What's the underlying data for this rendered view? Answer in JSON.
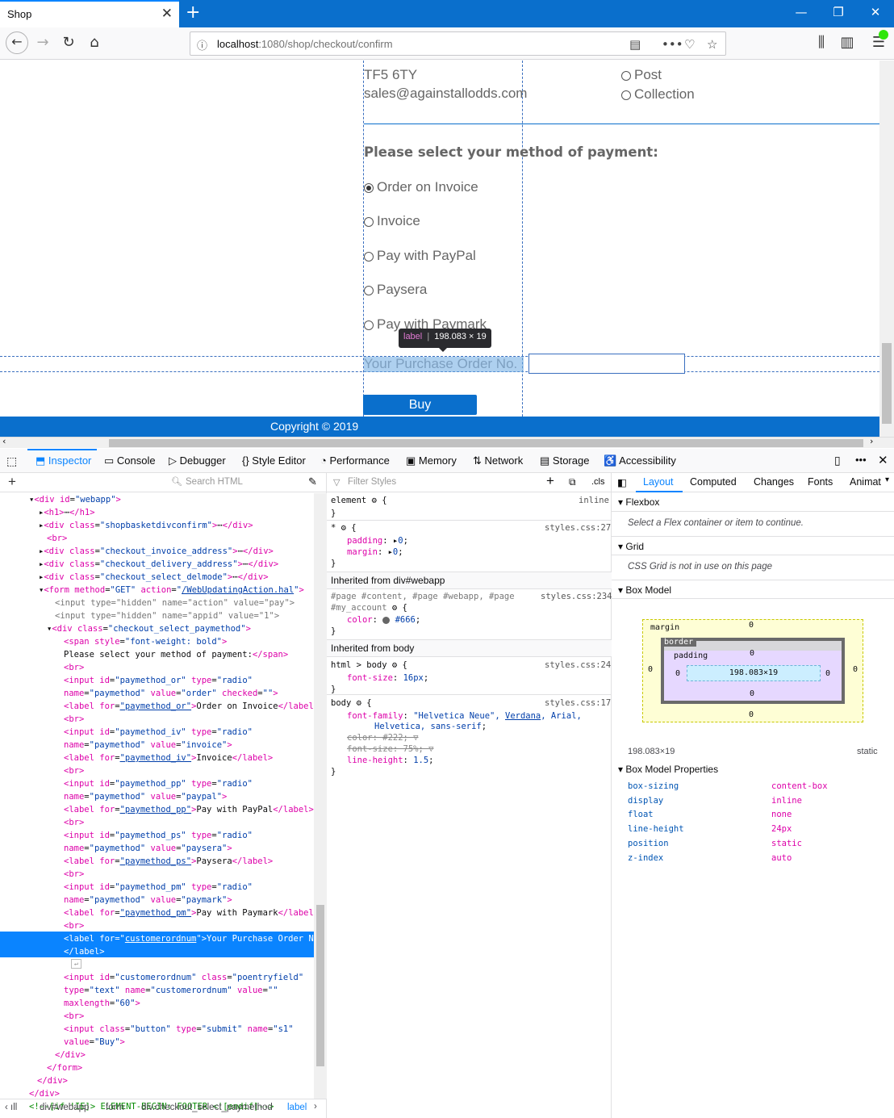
{
  "browser": {
    "tab_title": "Shop",
    "url_host": "localhost",
    "url_port_path": ":1080/shop/checkout/confirm"
  },
  "page": {
    "address_lines": [
      "TF5 6TY",
      "sales@againstallodds.com"
    ],
    "delivery_options": [
      "Post",
      "Collection"
    ],
    "payment_heading": "Please select your method of payment:",
    "payment_options": [
      "Order on Invoice",
      "Invoice",
      "Pay with PayPal",
      "Paysera",
      "Pay with Paymark"
    ],
    "selected_payment": "Order on Invoice",
    "po_label": "Your Purchase Order No.",
    "po_value": "",
    "buy_label": "Buy",
    "copyright": "Copyright © 2019",
    "tooltip_tag": "label",
    "tooltip_size": "198.083 × 19"
  },
  "devtools": {
    "tabs": [
      "Inspector",
      "Console",
      "Debugger",
      "Style Editor",
      "Performance",
      "Memory",
      "Network",
      "Storage",
      "Accessibility"
    ],
    "search_html_placeholder": "Search HTML",
    "filter_styles_placeholder": "Filter Styles",
    "cls_label": ".cls",
    "sidebar_tabs": [
      "Layout",
      "Computed",
      "Changes",
      "Fonts",
      "Animat"
    ],
    "flexbox_title": "Flexbox",
    "flexbox_msg": "Select a Flex container or item to continue.",
    "grid_title": "Grid",
    "grid_msg": "CSS Grid is not in use on this page",
    "boxmodel_title": "Box Model",
    "bm_margin": "margin",
    "bm_border": "border",
    "bm_padding": "padding",
    "bm_content": "198.083×19",
    "bm_zero": "0",
    "bm_size": "198.083×19",
    "bm_position": "static",
    "bm_props_title": "Box Model Properties",
    "bm_props": [
      {
        "k": "box-sizing",
        "v": "content-box"
      },
      {
        "k": "display",
        "v": "inline"
      },
      {
        "k": "float",
        "v": "none"
      },
      {
        "k": "line-height",
        "v": "24px"
      },
      {
        "k": "position",
        "v": "static"
      },
      {
        "k": "z-index",
        "v": "auto"
      }
    ],
    "breadcrumbs": [
      "div#webapp",
      "form",
      "div.checkout_select_paymethod",
      "label"
    ],
    "rules": {
      "element": "element",
      "inline": "inline",
      "star_src": "styles.css:27",
      "inh_webapp": "Inherited from div#webapp",
      "webapp_sel": "#page #content, #page #webapp, #page",
      "webapp_sel2": "#my_account",
      "webapp_src": "styles.css:234",
      "inh_body": "Inherited from body",
      "html_body_src": "styles.css:24",
      "body_src": "styles.css:17"
    }
  }
}
